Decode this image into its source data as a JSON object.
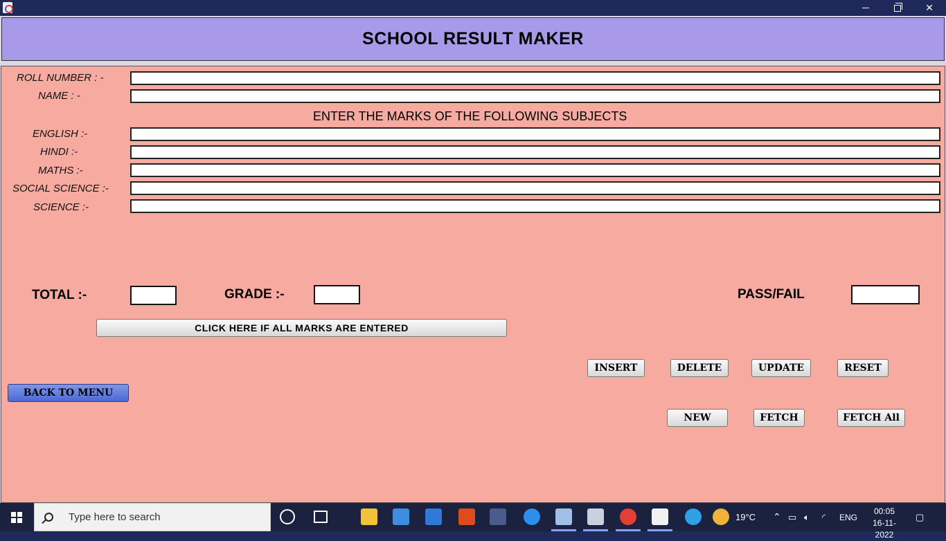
{
  "app": {
    "title": "SCHOOL RESULT MAKER"
  },
  "form": {
    "roll_label": "ROLL NUMBER : -",
    "name_label": "NAME : -",
    "marks_heading": "ENTER THE MARKS OF THE FOLLOWING SUBJECTS",
    "english_label": "ENGLISH :-",
    "hindi_label": "HINDI :-",
    "maths_label": "MATHS :-",
    "social_label": "SOCIAL SCIENCE :-",
    "science_label": "SCIENCE :-",
    "roll_value": "",
    "name_value": "",
    "english_value": "",
    "hindi_value": "",
    "maths_value": "",
    "social_value": "",
    "science_value": ""
  },
  "result": {
    "total_label": "TOTAL :-",
    "grade_label": "GRADE :-",
    "passfail_label": "PASS/FAIL",
    "total_value": "",
    "grade_value": "",
    "passfail_value": ""
  },
  "buttons": {
    "compute": "CLICK HERE IF ALL MARKS ARE ENTERED",
    "insert": "INSERT",
    "delete": "DELETE",
    "update": "UPDATE",
    "reset": "RESET",
    "back": "BACK TO MENU",
    "new": "NEW",
    "fetch": "FETCH",
    "fetch_all": "FETCH All"
  },
  "taskbar": {
    "search_placeholder": "Type here to search",
    "weather": "19°C",
    "language": "ENG",
    "time": "00:05",
    "date": "16-11-2022",
    "icons": [
      "task-view-icon",
      "file-explorer-icon",
      "microsoft-store-icon",
      "mail-icon",
      "office-icon",
      "sql-icon",
      "firefox-icon",
      "box-icon",
      "monitor-icon",
      "chrome-icon",
      "java-icon",
      "help-icon",
      "weather-icon"
    ]
  }
}
